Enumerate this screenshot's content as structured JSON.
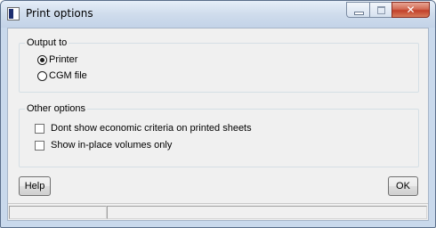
{
  "window": {
    "title": "Print options",
    "close_glyph": "✕"
  },
  "output": {
    "legend": "Output to",
    "options": [
      {
        "label": "Printer",
        "selected": true
      },
      {
        "label": "CGM file",
        "selected": false
      }
    ]
  },
  "other": {
    "legend": "Other options",
    "options": [
      {
        "label": "Dont show economic criteria on printed sheets",
        "checked": false
      },
      {
        "label": "Show in-place volumes only",
        "checked": false
      }
    ]
  },
  "buttons": {
    "help": "Help",
    "ok": "OK"
  },
  "statusbar": {
    "panes": [
      "",
      ""
    ]
  },
  "colors": {
    "titlebar": "#cfdcec",
    "client_bg": "#f0f0f0",
    "close_button": "#c2412a"
  }
}
